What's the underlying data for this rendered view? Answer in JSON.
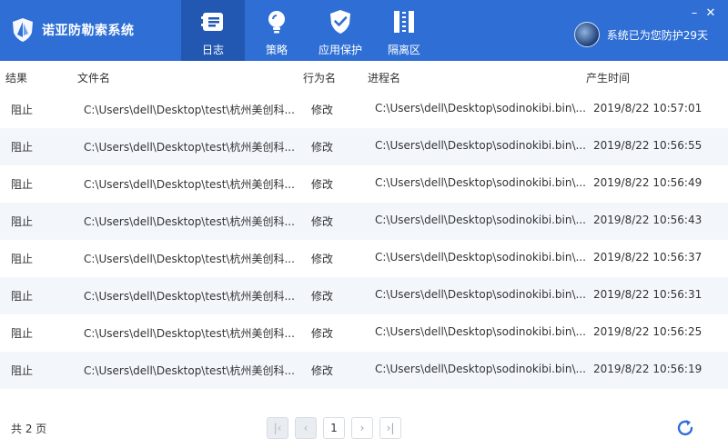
{
  "app": {
    "title": "诺亚防勒索系统"
  },
  "nav": [
    {
      "label": "日志",
      "icon": "log-icon",
      "active": true
    },
    {
      "label": "策略",
      "icon": "bulb-icon",
      "active": false
    },
    {
      "label": "应用保护",
      "icon": "shield-check-icon",
      "active": false
    },
    {
      "label": "隔离区",
      "icon": "quarantine-icon",
      "active": false
    }
  ],
  "status": {
    "text": "系统已为您防护29天"
  },
  "window": {
    "minimize": "–",
    "close": "✕"
  },
  "table": {
    "headers": {
      "result": "结果",
      "file": "文件名",
      "action": "行为名",
      "process": "进程名",
      "time": "产生时间"
    },
    "rows": [
      {
        "result": "阻止",
        "file": "C:\\Users\\dell\\Desktop\\test\\杭州美创科...",
        "action": "修改",
        "process": "C:\\Users\\dell\\Desktop\\sodinokibi.bin\\...",
        "time": "2019/8/22 10:57:01"
      },
      {
        "result": "阻止",
        "file": "C:\\Users\\dell\\Desktop\\test\\杭州美创科...",
        "action": "修改",
        "process": "C:\\Users\\dell\\Desktop\\sodinokibi.bin\\...",
        "time": "2019/8/22 10:56:55"
      },
      {
        "result": "阻止",
        "file": "C:\\Users\\dell\\Desktop\\test\\杭州美创科...",
        "action": "修改",
        "process": "C:\\Users\\dell\\Desktop\\sodinokibi.bin\\...",
        "time": "2019/8/22 10:56:49"
      },
      {
        "result": "阻止",
        "file": "C:\\Users\\dell\\Desktop\\test\\杭州美创科...",
        "action": "修改",
        "process": "C:\\Users\\dell\\Desktop\\sodinokibi.bin\\...",
        "time": "2019/8/22 10:56:43"
      },
      {
        "result": "阻止",
        "file": "C:\\Users\\dell\\Desktop\\test\\杭州美创科...",
        "action": "修改",
        "process": "C:\\Users\\dell\\Desktop\\sodinokibi.bin\\...",
        "time": "2019/8/22 10:56:37"
      },
      {
        "result": "阻止",
        "file": "C:\\Users\\dell\\Desktop\\test\\杭州美创科...",
        "action": "修改",
        "process": "C:\\Users\\dell\\Desktop\\sodinokibi.bin\\...",
        "time": "2019/8/22 10:56:31"
      },
      {
        "result": "阻止",
        "file": "C:\\Users\\dell\\Desktop\\test\\杭州美创科...",
        "action": "修改",
        "process": "C:\\Users\\dell\\Desktop\\sodinokibi.bin\\...",
        "time": "2019/8/22 10:56:25"
      },
      {
        "result": "阻止",
        "file": "C:\\Users\\dell\\Desktop\\test\\杭州美创科...",
        "action": "修改",
        "process": "C:\\Users\\dell\\Desktop\\sodinokibi.bin\\...",
        "time": "2019/8/22 10:56:19"
      }
    ]
  },
  "footer": {
    "total": "共 2 页",
    "pager": {
      "first": "|‹",
      "prev": "‹",
      "current": "1",
      "next": "›",
      "last": "›|"
    }
  },
  "colors": {
    "header_blue": "#2f6fd5",
    "active_tab": "#2358b2",
    "row_alt": "#f3f7fc",
    "refresh": "#2f6fd5"
  }
}
